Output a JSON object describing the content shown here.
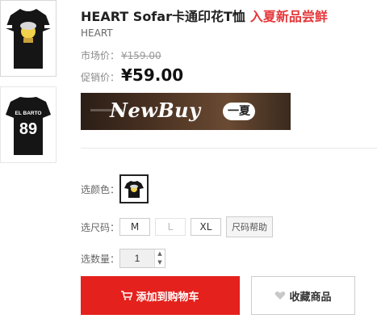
{
  "product": {
    "title": "HEART Sofar卡通印花T恤",
    "promo_tag": "入夏新品尝鲜",
    "brand": "HEART",
    "market_price_label": "市场价：",
    "market_price": "¥159.00",
    "sale_price_label": "促销价：",
    "sale_price": "¥59.00"
  },
  "thumbnails": [
    {
      "icon": "tshirt-front-cartoon",
      "alt": "front"
    },
    {
      "icon": "tshirt-back-89",
      "alt": "back",
      "back_text": "EL BARTO",
      "back_number": "89"
    }
  ],
  "banner": {
    "text": "NewBuy",
    "badge": "一夏"
  },
  "options": {
    "color_label": "选颜色：",
    "size_label": "选尺码：",
    "sizes": [
      {
        "label": "M",
        "available": true
      },
      {
        "label": "L",
        "available": false
      },
      {
        "label": "XL",
        "available": true
      }
    ],
    "size_help": "尺码帮助",
    "qty_label": "选数量：",
    "qty_value": "1"
  },
  "actions": {
    "add_to_cart": "添加到购物车",
    "favorite": "收藏商品"
  },
  "colors": {
    "accent_red": "#e4211c",
    "promo_red": "#e4393c"
  }
}
